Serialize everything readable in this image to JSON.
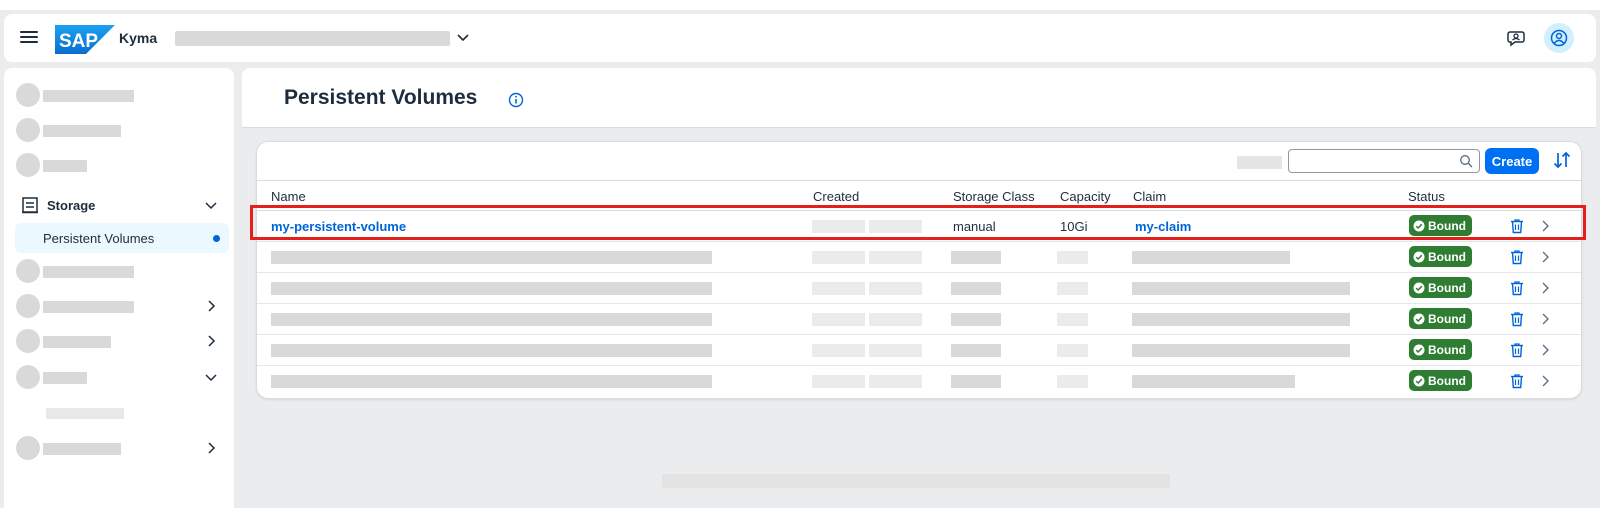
{
  "shellbar": {
    "logo_text": "SAP",
    "product_name": "Kyma"
  },
  "sidebar": {
    "storage_label": "Storage",
    "active_item_label": "Persistent Volumes"
  },
  "page": {
    "title": "Persistent Volumes"
  },
  "toolbar": {
    "search_placeholder": "",
    "create_label": "Create"
  },
  "table": {
    "columns": [
      "Name",
      "Created",
      "Storage Class",
      "Capacity",
      "Claim",
      "Status"
    ],
    "rows": [
      {
        "name": "my-persistent-volume",
        "storage_class": "manual",
        "capacity": "10Gi",
        "claim": "my-claim",
        "status": "Bound"
      },
      {
        "status": "Bound"
      },
      {
        "status": "Bound"
      },
      {
        "status": "Bound"
      },
      {
        "status": "Bound"
      },
      {
        "status": "Bound"
      }
    ]
  },
  "colors": {
    "accent": "#0070f2",
    "link": "#0064d9",
    "status_bound": "#2e7d32",
    "highlight": "#e3201c"
  },
  "icons": [
    "menu-icon",
    "chevron-down-icon",
    "feedback-icon",
    "user-icon",
    "storage-icon",
    "info-icon",
    "search-icon",
    "sort-icon",
    "check-circle-icon",
    "trash-icon",
    "chevron-right-icon"
  ]
}
